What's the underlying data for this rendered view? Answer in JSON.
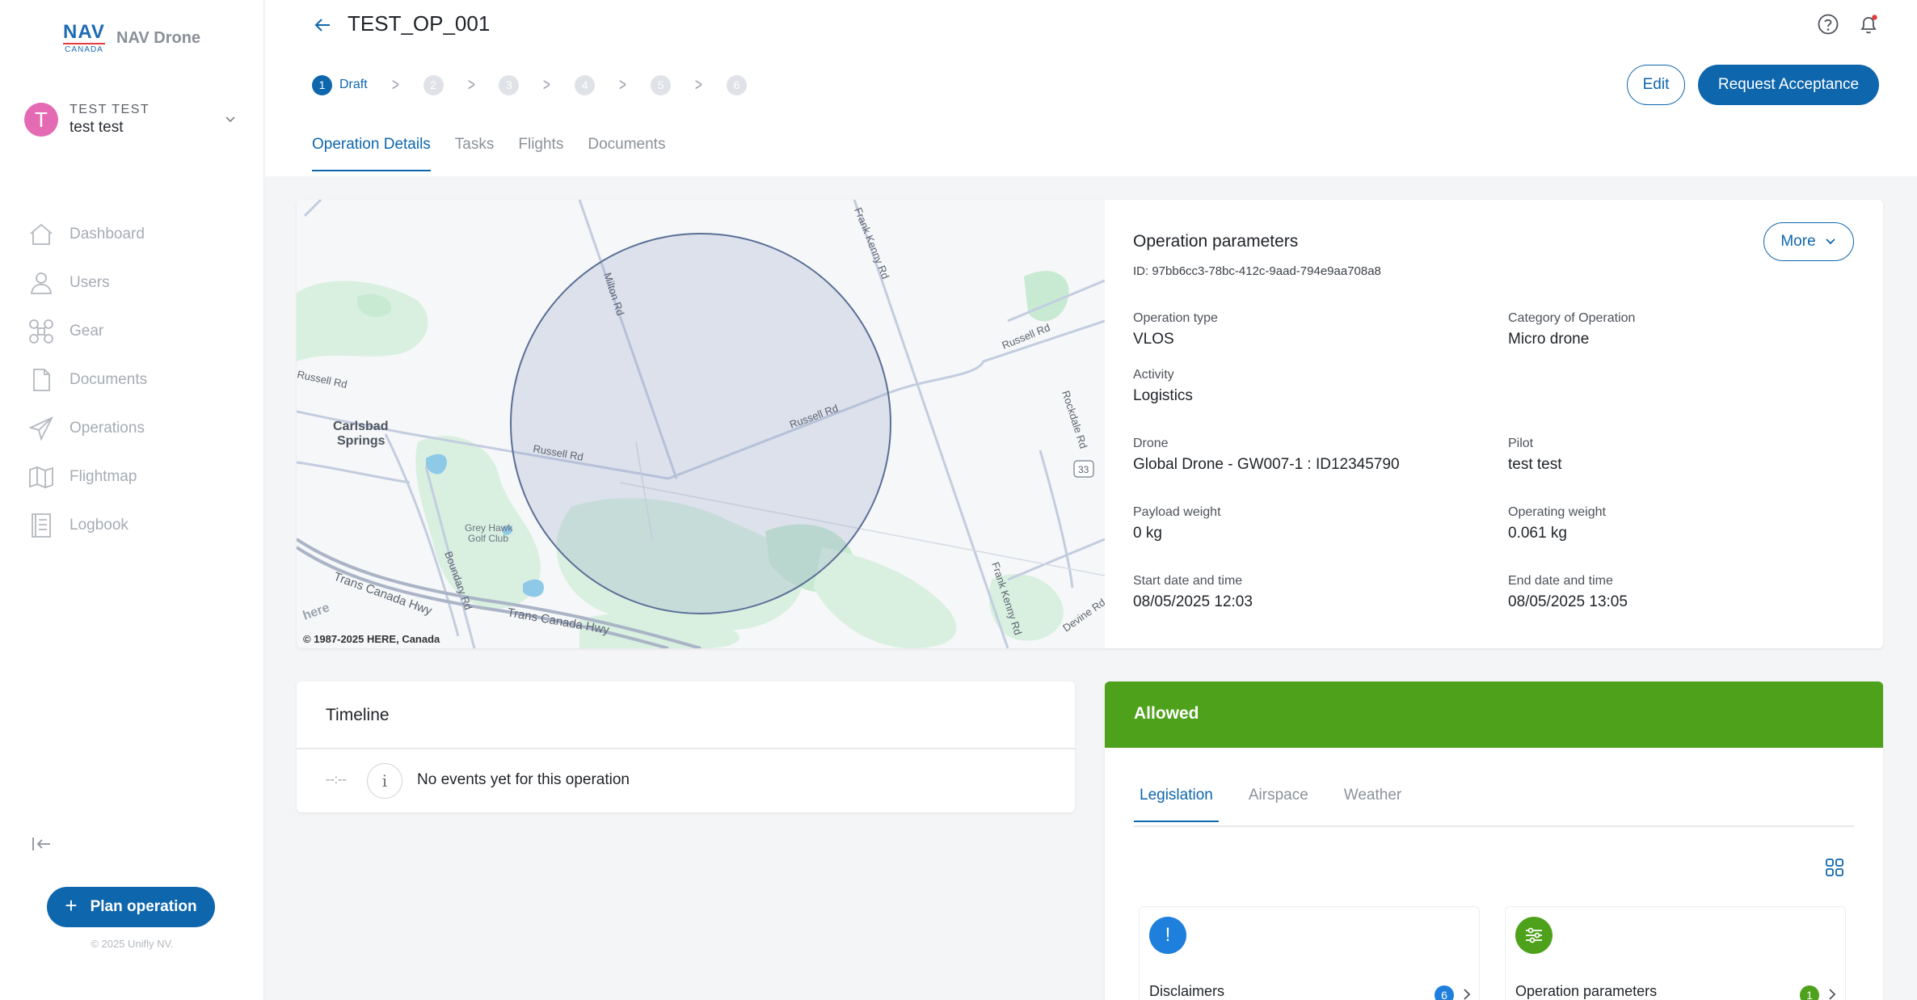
{
  "brand": {
    "logo_line1": "NAV",
    "logo_line2": "CANADA",
    "app_name": "NAV Drone"
  },
  "user": {
    "initial": "T",
    "name": "TEST TEST",
    "subtitle": "test test"
  },
  "sidebar": {
    "items": [
      {
        "label": "Dashboard",
        "icon": "home-icon"
      },
      {
        "label": "Users",
        "icon": "user-icon"
      },
      {
        "label": "Gear",
        "icon": "drone-icon"
      },
      {
        "label": "Documents",
        "icon": "document-icon"
      },
      {
        "label": "Operations",
        "icon": "paper-plane-icon"
      },
      {
        "label": "Flightmap",
        "icon": "map-icon"
      },
      {
        "label": "Logbook",
        "icon": "logbook-icon"
      }
    ],
    "plan_button": "Plan operation",
    "copyright": "© 2025 Unifly NV."
  },
  "header": {
    "title": "TEST_OP_001",
    "steps": [
      {
        "num": "1",
        "label": "Draft"
      },
      {
        "num": "2"
      },
      {
        "num": "3"
      },
      {
        "num": "4"
      },
      {
        "num": "5"
      },
      {
        "num": "6"
      }
    ],
    "edit_label": "Edit",
    "request_label": "Request Acceptance",
    "tabs": [
      "Operation Details",
      "Tasks",
      "Flights",
      "Documents"
    ]
  },
  "map": {
    "copyright": "© 1987-2025 HERE, Canada",
    "labels": {
      "milton": "Milton Rd",
      "frank1": "Frank Kenny Rd",
      "frank2": "Frank Kenny Rd",
      "russell_top": "Russell Rd",
      "russell_left": "Russell Rd",
      "russell_mid": "Russell Rd",
      "russell_center": "Russell Rd",
      "rockdale": "Rockdale Rd",
      "carlsbad1": "Carlsbad",
      "carlsbad2": "Springs",
      "greyhawk1": "Grey Hawk",
      "greyhawk2": "Golf Club",
      "boundary": "Boundary Rd",
      "tch1": "Trans Canada Hwy",
      "tch2": "Trans Canada Hwy",
      "devine": "Devine Rd",
      "shield": "33",
      "here": "here"
    }
  },
  "params": {
    "title": "Operation parameters",
    "id_text": "ID: 97bb6cc3-78bc-412c-9aad-794e9aa708a8",
    "more_label": "More",
    "op_type_label": "Operation type",
    "op_type": "VLOS",
    "category_label": "Category of Operation",
    "category": "Micro drone",
    "activity_label": "Activity",
    "activity": "Logistics",
    "drone_label": "Drone",
    "drone": "Global Drone - GW007-1 : ID12345790",
    "pilot_label": "Pilot",
    "pilot": "test test",
    "payload_label": "Payload weight",
    "payload": "0 kg",
    "opweight_label": "Operating weight",
    "opweight": "0.061 kg",
    "start_label": "Start date and time",
    "start": "08/05/2025 12:03",
    "end_label": "End date and time",
    "end": "08/05/2025 13:05"
  },
  "timeline": {
    "title": "Timeline",
    "time": "--:--",
    "info": "i",
    "empty": "No events yet for this operation"
  },
  "allowed": {
    "title": "Allowed",
    "tabs": [
      "Legislation",
      "Airspace",
      "Weather"
    ],
    "cards": [
      {
        "label": "Disclaimers",
        "count": "6",
        "icon_text": "!"
      },
      {
        "label": "Operation parameters",
        "count": "1"
      }
    ]
  },
  "colors": {
    "primary": "#0e66ad",
    "allowed_green": "#4ea11a",
    "avatar": "#e56ab4"
  }
}
